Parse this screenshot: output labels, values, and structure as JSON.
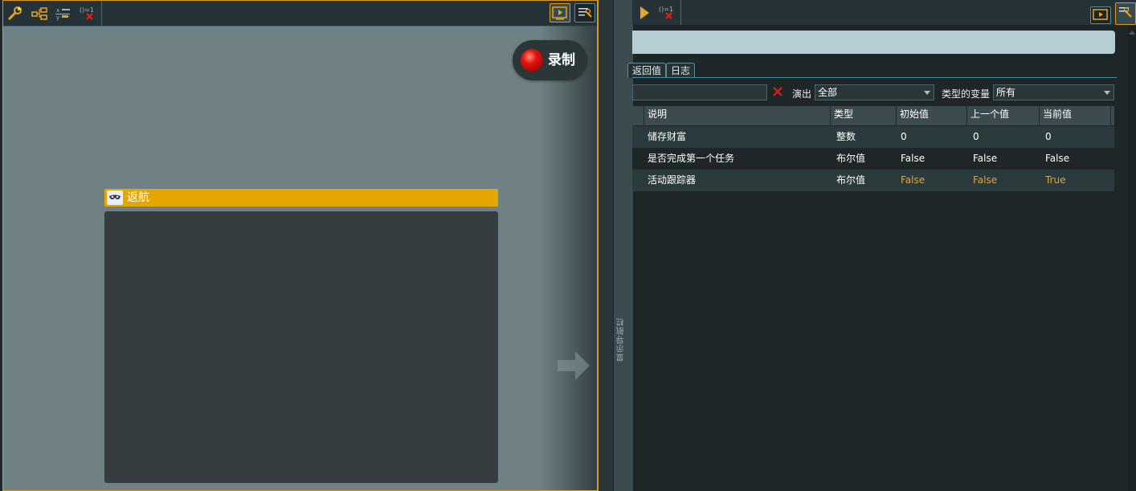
{
  "left_panel": {
    "tools": [
      "wrench-star-icon",
      "flow-node-icon",
      "variable-list-icon",
      "function-clear-icon"
    ],
    "record_label": "录制",
    "node": {
      "title": "返航",
      "icon": "mask-icon"
    }
  },
  "divider": {
    "label": "显示导航栏"
  },
  "right_panel": {
    "tabs": [
      {
        "label": "返回值"
      },
      {
        "label": "日志"
      }
    ],
    "filter": {
      "placeholder": "",
      "cast_label": "演出",
      "cast_value": "全部",
      "var_type_label": "类型的变量",
      "var_type_value": "所有"
    },
    "columns": [
      "说明",
      "类型",
      "初始值",
      "上一个值",
      "当前值"
    ],
    "rows": [
      {
        "desc": "储存财富",
        "type": "整数",
        "initial": "0",
        "previous": "0",
        "current": "0",
        "changed": false
      },
      {
        "desc": "是否完成第一个任务",
        "type": "布尔值",
        "initial": "False",
        "previous": "False",
        "current": "False",
        "changed": false
      },
      {
        "desc": "活动跟踪器",
        "type": "布尔值",
        "initial": "False",
        "previous": "False",
        "current": "True",
        "changed": true
      }
    ]
  },
  "colors": {
    "accent": "#e3a700",
    "changed_value": "#e8a325",
    "record_red": "#e0140c"
  }
}
